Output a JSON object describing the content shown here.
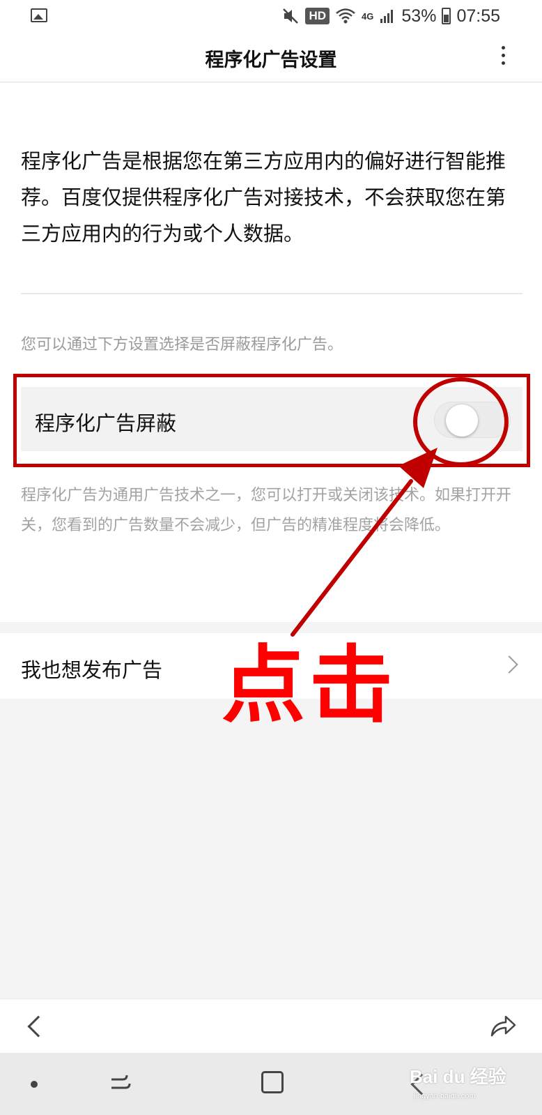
{
  "status_bar": {
    "left_icon": "gallery-icon",
    "icons": [
      "mute-icon",
      "wifi-icon",
      "signal-icon"
    ],
    "hd_badge": "HD",
    "network": "4G",
    "battery": "53%",
    "time": "07:55"
  },
  "header": {
    "title": "程序化广告设置",
    "menu_icon": "more-vertical-icon"
  },
  "main": {
    "intro": "程序化广告是根据您在第三方应用内的偏好进行智能推荐。百度仅提供程序化广告对接技术，不会获取您在第三方应用内的行为或个人数据。",
    "hint": "您可以通过下方设置选择是否屏蔽程序化广告。",
    "toggle": {
      "label": "程序化广告屏蔽",
      "state": "off"
    },
    "description": "程序化广告为通用广告技术之一，您可以打开或关闭该技术。如果打开开关，您看到的广告数量不会减少，但广告的精准程度将会降低。"
  },
  "publish_row": {
    "label": "我也想发布广告",
    "icon": "chevron-right-icon"
  },
  "toolbar": {
    "back_icon": "back-icon",
    "share_icon": "share-icon"
  },
  "nav_bar": {
    "icons": [
      "nav-dot-icon",
      "recents-icon",
      "home-icon",
      "nav-back-icon"
    ]
  },
  "annotation": {
    "text": "点击",
    "color": "#ff0000",
    "outline_color": "#c00000"
  },
  "watermark": {
    "main": "Bai du 经验",
    "sub": "jingyan.baidu.com"
  },
  "colors": {
    "background": "#f4f4f4",
    "card": "#ffffff",
    "muted_text": "#a2a2a2"
  }
}
